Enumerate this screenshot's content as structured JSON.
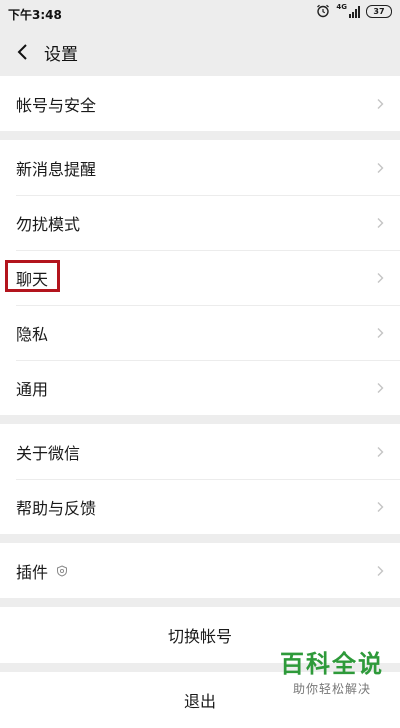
{
  "status_bar": {
    "time": "下午3:48",
    "network": "4G",
    "battery": "37"
  },
  "header": {
    "title": "设置"
  },
  "groups": [
    {
      "items": [
        {
          "label": "帐号与安全"
        }
      ]
    },
    {
      "items": [
        {
          "label": "新消息提醒"
        },
        {
          "label": "勿扰模式"
        },
        {
          "label": "聊天"
        },
        {
          "label": "隐私"
        },
        {
          "label": "通用"
        }
      ]
    },
    {
      "items": [
        {
          "label": "关于微信"
        },
        {
          "label": "帮助与反馈"
        }
      ]
    },
    {
      "items": [
        {
          "label": "插件"
        }
      ]
    }
  ],
  "actions": {
    "switch_account": "切换帐号",
    "logout": "退出"
  },
  "watermark": {
    "main": "百科全说",
    "sub": "助你轻松解决"
  },
  "colors": {
    "background": "#ededed",
    "highlight": "#b3141d",
    "watermark": "#2e9a3a"
  }
}
